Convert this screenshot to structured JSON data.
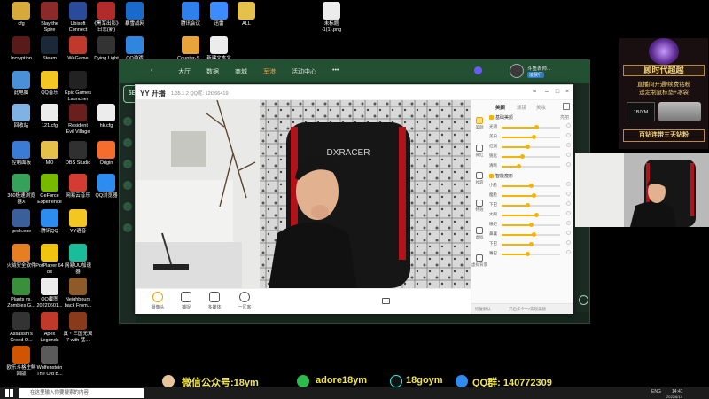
{
  "desktop": {
    "icons": [
      {
        "label": "cfg",
        "color": "#d6a93a"
      },
      {
        "label": "Slay the\nSpire",
        "color": "#8a2a2a"
      },
      {
        "label": "Ubisoft\nConnect",
        "color": "#2a4a9a"
      },
      {
        "label": "《黑军出影》\n日志(新)",
        "color": "#b32a2a"
      },
      {
        "label": "暴雪战网",
        "color": "#1a6acb"
      },
      {
        "label": "腾讯会议",
        "color": "#2f80ed"
      },
      {
        "label": "迅雷",
        "color": "#3d8cff"
      },
      {
        "label": "ALL",
        "color": "#e5c04a"
      },
      {
        "label": "未标题\n-1(1).png",
        "color": "#ececec"
      },
      {
        "label": "Incryption",
        "color": "#5a1a1a"
      },
      {
        "label": "Steam",
        "color": "#1b2838"
      },
      {
        "label": "WeGame",
        "color": "#c0392b"
      },
      {
        "label": "Dying Light",
        "color": "#333333"
      },
      {
        "label": "QQ游戏",
        "color": "#2e86de"
      },
      {
        "label": "Counter-S...",
        "color": "#e8a33a"
      },
      {
        "label": "新建文本文",
        "color": "#ececec"
      },
      {
        "label": "此电脑",
        "color": "#4a90d9"
      },
      {
        "label": "QQ音乐",
        "color": "#f3c623"
      },
      {
        "label": "Epic Games\nLauncher",
        "color": "#222222"
      },
      {
        "label": "回收站",
        "color": "#7fb2e5"
      },
      {
        "label": "121.cfg",
        "color": "#ececec"
      },
      {
        "label": "Resident\nEvil Village",
        "color": "#6b1e1e"
      },
      {
        "label": "hk.cfg",
        "color": "#ececec"
      },
      {
        "label": "控制面板",
        "color": "#3a7bd5"
      },
      {
        "label": "MO",
        "color": "#e5c04a"
      },
      {
        "label": "OBS Studio",
        "color": "#303030"
      },
      {
        "label": "Origin",
        "color": "#f56c2d"
      },
      {
        "label": "360极速浏览\n器X",
        "color": "#36a15b"
      },
      {
        "label": "GeForce\nExperience",
        "color": "#76b900"
      },
      {
        "label": "网易云音乐",
        "color": "#d43c33"
      },
      {
        "label": "QQ浏览器",
        "color": "#2d8cf0"
      },
      {
        "label": "geek.exe",
        "color": "#3a5f9a"
      },
      {
        "label": "腾讯QQ",
        "color": "#2d8cf0"
      },
      {
        "label": "YY语音",
        "color": "#f3c623"
      },
      {
        "label": "火绒安全软件",
        "color": "#e67e22"
      },
      {
        "label": "PotPlayer 64\nbit",
        "color": "#f1c40f"
      },
      {
        "label": "网易UU加速\n器",
        "color": "#1abc9c"
      },
      {
        "label": "Plants vs.\nZombies G...",
        "color": "#3a8f3a"
      },
      {
        "label": "QQ截图\n20220601...",
        "color": "#ececec"
      },
      {
        "label": "Neighbours\nback From...",
        "color": "#8e5a2a"
      },
      {
        "label": "Assassin's\nCreed O...",
        "color": "#333333"
      },
      {
        "label": "Apex\nLegends",
        "color": "#c0392b"
      },
      {
        "label": "真・三国无双\n7 with 猛...",
        "color": "#8a3a1a"
      },
      {
        "label": "欧乐斗格庄鲜\n回版",
        "color": "#d35400"
      },
      {
        "label": "Wolfenstein\nThe Old B...",
        "color": "#5a5a5a"
      }
    ]
  },
  "game_client": {
    "nav": [
      "大厅",
      "数据",
      "商城",
      "军港",
      "活动中心",
      "•••"
    ],
    "active_nav": "军港",
    "logo": "5E",
    "username": "斗鱼表师...",
    "badge": "凌晨行"
  },
  "yy_window": {
    "logo": "YY 开播",
    "version": "1.35.1.2  QQ昵: 12t366419",
    "tools": [
      "摄像头",
      "捕捉",
      "多媒体",
      "一区客"
    ],
    "panel": {
      "tabs": [
        "美颜",
        "滤镜",
        "美妆"
      ],
      "active_tab": "美颜",
      "side": [
        "美颜",
        "微红",
        "妆容",
        "特效",
        "虚拟",
        "虚拟背景"
      ],
      "section1": {
        "title": "基础美颜",
        "mode": "亮丽",
        "sliders": [
          {
            "label": "光滑",
            "value": 0.6
          },
          {
            "label": "美白",
            "value": 0.55
          },
          {
            "label": "红润",
            "value": 0.45
          },
          {
            "label": "锐化",
            "value": 0.35
          },
          {
            "label": "清晰",
            "value": 0.3
          }
        ]
      },
      "section2": {
        "title": "智能瘦形",
        "sliders": [
          {
            "label": "小脸",
            "value": 0.5
          },
          {
            "label": "瘦脸",
            "value": 0.55
          },
          {
            "label": "下巴",
            "value": 0.45
          },
          {
            "label": "大眼",
            "value": 0.6
          },
          {
            "label": "眼距",
            "value": 0.5
          },
          {
            "label": "鼻翼",
            "value": 0.55
          },
          {
            "label": "下巴",
            "value": 0.5
          },
          {
            "label": "嘴巴",
            "value": 0.45
          }
        ]
      },
      "footer_left": "恢复默认",
      "footer_right": "开启多个YY实现美颜",
      "footer_btn": "美颜"
    }
  },
  "promo": {
    "title": "顾时代超越",
    "line1": "直播间开通/续费钻粉",
    "line2": "送定制鼠标垫+冰袋",
    "box": "1B/YM",
    "footer": "百钻连带三天钻粉"
  },
  "banner": {
    "wechat_public": "微信公众号:18ym",
    "wechat": "adore18ym",
    "douyin": "18goym",
    "qq_group": "QQ群: 140772309"
  },
  "taskbar": {
    "search_placeholder": "在这里输入你要搜索的内容",
    "lang": "ENG",
    "time": "14:41",
    "date": "2022/6/14"
  }
}
